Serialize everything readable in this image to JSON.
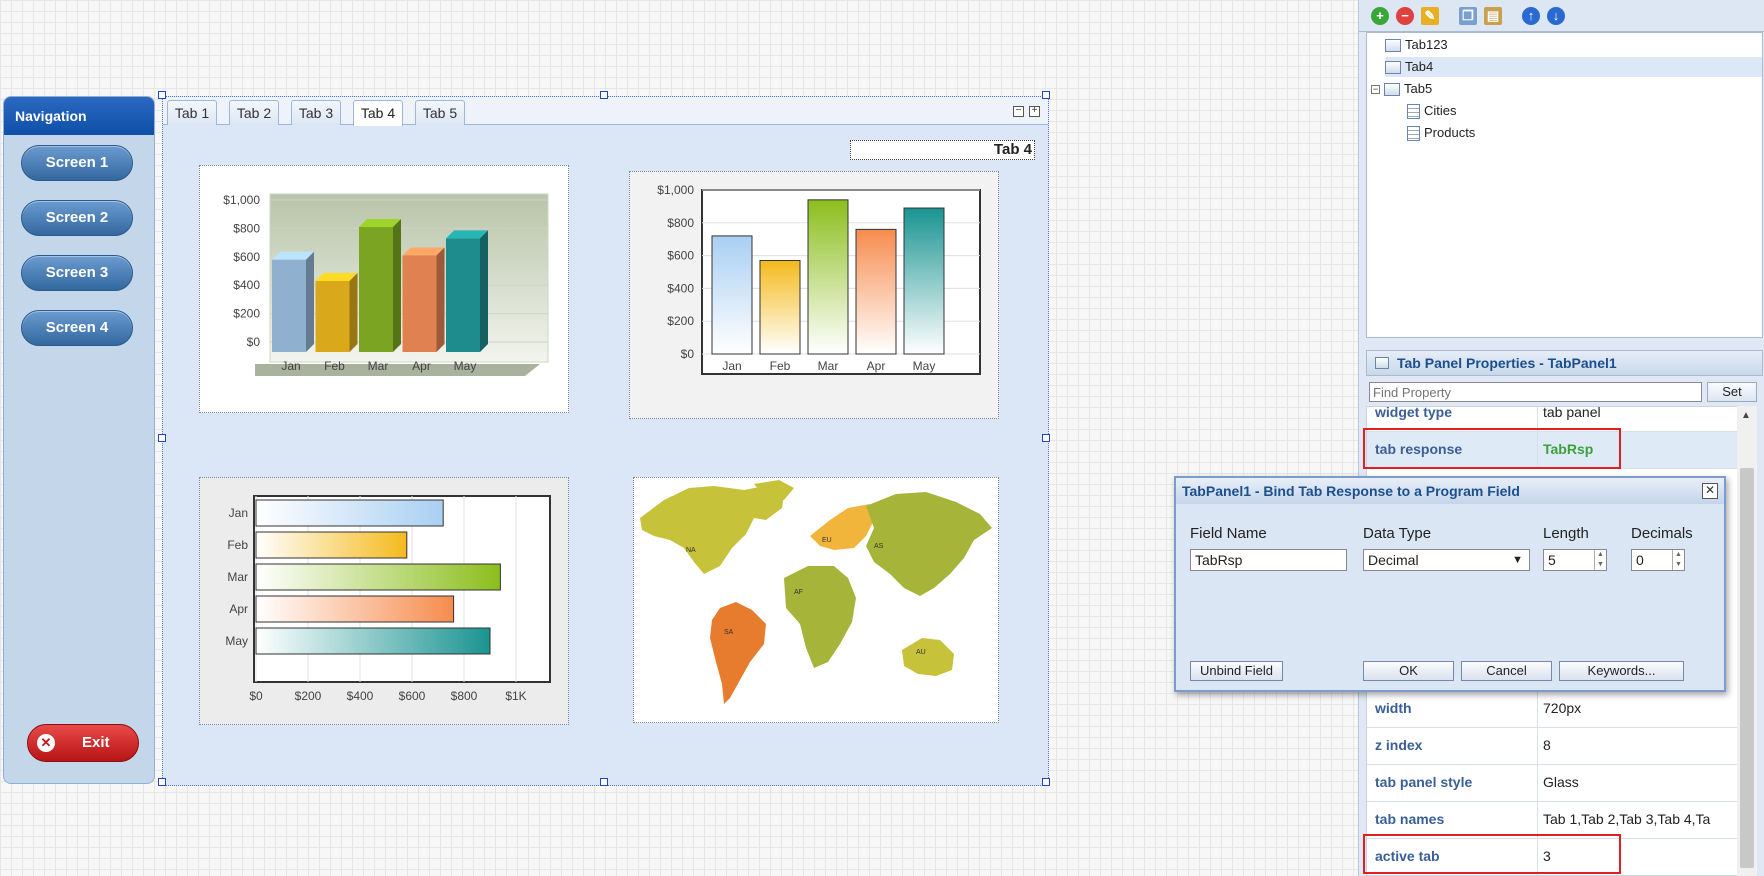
{
  "navigation": {
    "title": "Navigation",
    "buttons": [
      "Screen 1",
      "Screen 2",
      "Screen 3",
      "Screen 4"
    ],
    "exit_label": "Exit"
  },
  "tab_panel": {
    "tabs": [
      "Tab 1",
      "Tab 2",
      "Tab 3",
      "Tab 4",
      "Tab 5"
    ],
    "active_tab_index": 3,
    "tab_label": "Tab 4"
  },
  "chart_data": [
    {
      "type": "bar",
      "style": "3d",
      "categories": [
        "Jan",
        "Feb",
        "Mar",
        "Apr",
        "May"
      ],
      "values": [
        650,
        500,
        880,
        680,
        800
      ],
      "yticks": [
        "$1,000",
        "$800",
        "$600",
        "$400",
        "$200",
        "$0"
      ],
      "ylim": [
        0,
        1000
      ],
      "colors": [
        "#8fb0cf",
        "#d9a91b",
        "#7aa421",
        "#df8150",
        "#1e8b8c"
      ]
    },
    {
      "type": "bar",
      "categories": [
        "Jan",
        "Feb",
        "Mar",
        "Apr",
        "May"
      ],
      "values": [
        720,
        570,
        940,
        760,
        890
      ],
      "yticks": [
        "$1,000",
        "$800",
        "$600",
        "$400",
        "$200",
        "$0"
      ],
      "ylim": [
        0,
        1000
      ],
      "colors": [
        "#a9cff2",
        "#f4ba1d",
        "#8cbe1d",
        "#f68c4e",
        "#1a9491"
      ]
    },
    {
      "type": "bar",
      "orientation": "horizontal",
      "categories": [
        "Jan",
        "Feb",
        "Mar",
        "Apr",
        "May"
      ],
      "values": [
        720,
        580,
        940,
        760,
        900
      ],
      "xticks": [
        "$0",
        "$200",
        "$400",
        "$600",
        "$800",
        "$1K"
      ],
      "xlim": [
        0,
        1000
      ],
      "colors": [
        "#a9cff2",
        "#f4ba1d",
        "#8cbe1d",
        "#f68c4e",
        "#1a9491"
      ]
    }
  ],
  "map": {
    "regions": [
      "NA",
      "EU",
      "AS",
      "AF",
      "SA",
      "AU"
    ]
  },
  "right_panel": {
    "tree": [
      {
        "label": "Tab123"
      },
      {
        "label": "Tab4"
      },
      {
        "label": "Tab5"
      },
      {
        "label": "Cities"
      },
      {
        "label": "Products"
      }
    ],
    "properties_title": "Tab Panel Properties - TabPanel1",
    "find_placeholder": "Find Property",
    "set_label": "Set",
    "properties": [
      {
        "name": "widget type",
        "value": "tab panel"
      },
      {
        "name": "tab response",
        "value": "TabRsp"
      },
      {
        "name": "width",
        "value": "720px"
      },
      {
        "name": "z index",
        "value": "8"
      },
      {
        "name": "tab panel style",
        "value": "Glass"
      },
      {
        "name": "tab names",
        "value": "Tab 1,Tab 2,Tab 3,Tab 4,Ta"
      },
      {
        "name": "active tab",
        "value": "3"
      }
    ]
  },
  "dialog": {
    "title": "TabPanel1 - Bind Tab Response to a Program Field",
    "field_name_label": "Field Name",
    "data_type_label": "Data Type",
    "length_label": "Length",
    "decimals_label": "Decimals",
    "field_name_value": "TabRsp",
    "data_type_value": "Decimal",
    "length_value": "5",
    "decimals_value": "0",
    "buttons": {
      "unbind": "Unbind Field",
      "ok": "OK",
      "cancel": "Cancel",
      "keywords": "Keywords..."
    }
  }
}
